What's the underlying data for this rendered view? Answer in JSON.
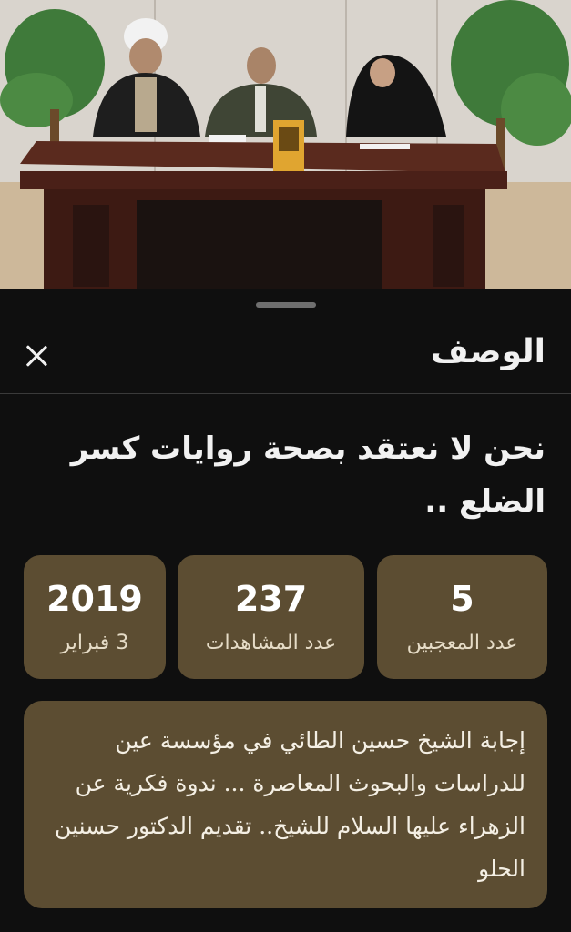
{
  "sheet": {
    "title": "الوصف",
    "close_icon": "close-icon",
    "handle_icon": "drag-handle-icon"
  },
  "video": {
    "title": "نحن لا نعتقد بصحة روايات كسر الضلع .."
  },
  "stats": {
    "likes": {
      "value": "5",
      "label": "عدد المعجبين"
    },
    "views": {
      "value": "237",
      "label": "عدد المشاهدات"
    },
    "date": {
      "value": "2019",
      "label": "3 فبراير"
    }
  },
  "description": {
    "text": "إجابة الشيخ  حسين الطائي في مؤسسة عين للدراسات والبحوث المعاصرة ... ندوة فكرية عن الزهراء عليها السلام للشيخ.. تقديم الدكتور حسنين الحلو"
  },
  "colors": {
    "background": "#0f0f0f",
    "card": "#5c4d32",
    "text": "#f1f1f1"
  }
}
